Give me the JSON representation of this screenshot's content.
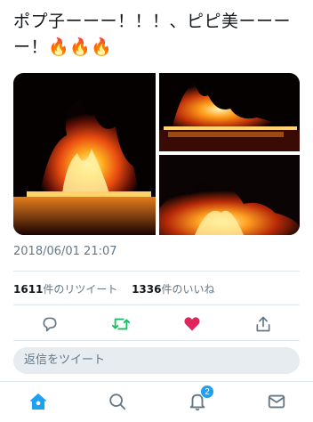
{
  "tweet": {
    "text": "ポプ子ーーー！！！、ピピ美ーーーー！🔥🔥🔥",
    "timestamp": "2018/06/01 21:07"
  },
  "stats": {
    "retweets_count": "1611",
    "retweets_label": "件のリツイート",
    "likes_count": "1336",
    "likes_label": "件のいいね"
  },
  "actions": {
    "reply_icon": "comment-icon",
    "retweet_icon": "retweet-icon",
    "like_icon": "heart-icon",
    "share_icon": "share-icon",
    "retweet_color": "#17bf63",
    "like_color": "#e0245e"
  },
  "reply": {
    "placeholder": "返信をツイート"
  },
  "tabbar": {
    "items": [
      {
        "icon": "home-icon",
        "active": true
      },
      {
        "icon": "search-icon"
      },
      {
        "icon": "bell-icon",
        "badge": "2"
      },
      {
        "icon": "mail-icon"
      }
    ],
    "accent": "#1da1f2"
  }
}
